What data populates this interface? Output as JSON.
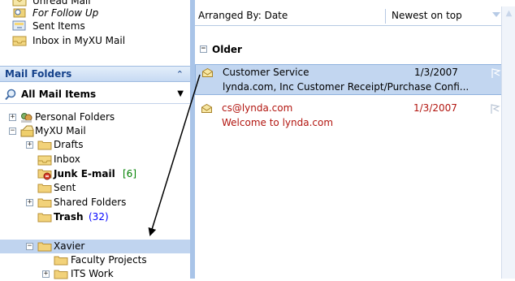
{
  "favorites": [
    {
      "label": "Unread Mail",
      "italic": false,
      "icon": "unread-mail-icon"
    },
    {
      "label": "For Follow Up",
      "italic": true,
      "icon": "follow-up-folder-icon"
    },
    {
      "label": "Sent Items",
      "italic": false,
      "icon": "sent-items-icon"
    },
    {
      "label": "Inbox in MyXU Mail",
      "italic": false,
      "icon": "inbox-icon"
    }
  ],
  "mail_folders": {
    "title": "Mail Folders",
    "collapse_icon": "double-chevron-up-icon",
    "all_mail_items": "All Mail Items",
    "dropdown_icon": "dropdown-arrow-icon"
  },
  "tree": {
    "personal_folders": "Personal Folders",
    "myxu_mail": "MyXU Mail",
    "drafts": "Drafts",
    "inbox": "Inbox",
    "junk": "Junk E-mail",
    "junk_count": "[6]",
    "sent": "Sent",
    "shared": "Shared Folders",
    "trash": "Trash",
    "trash_count": "(32)",
    "xavier": "Xavier",
    "faculty_projects": "Faculty Projects",
    "its_work": "ITS Work"
  },
  "message_list": {
    "arranged_by": "Arranged By: Date",
    "sort_order": "Newest on top",
    "group_label": "Older",
    "messages": [
      {
        "from": "Customer Service",
        "date": "1/3/2007",
        "subject": "lynda.com, Inc Customer Receipt/Purchase Confi...",
        "selected": true,
        "unread": false
      },
      {
        "from": "cs@lynda.com",
        "date": "1/3/2007",
        "subject": "Welcome to lynda.com",
        "selected": false,
        "unread": true
      }
    ]
  },
  "colors": {
    "accent": "#15428b",
    "selection": "#c2d6f0",
    "unread_red": "#b2150f",
    "count_blue": "#0000ff",
    "junk_count_green": "#008000"
  }
}
